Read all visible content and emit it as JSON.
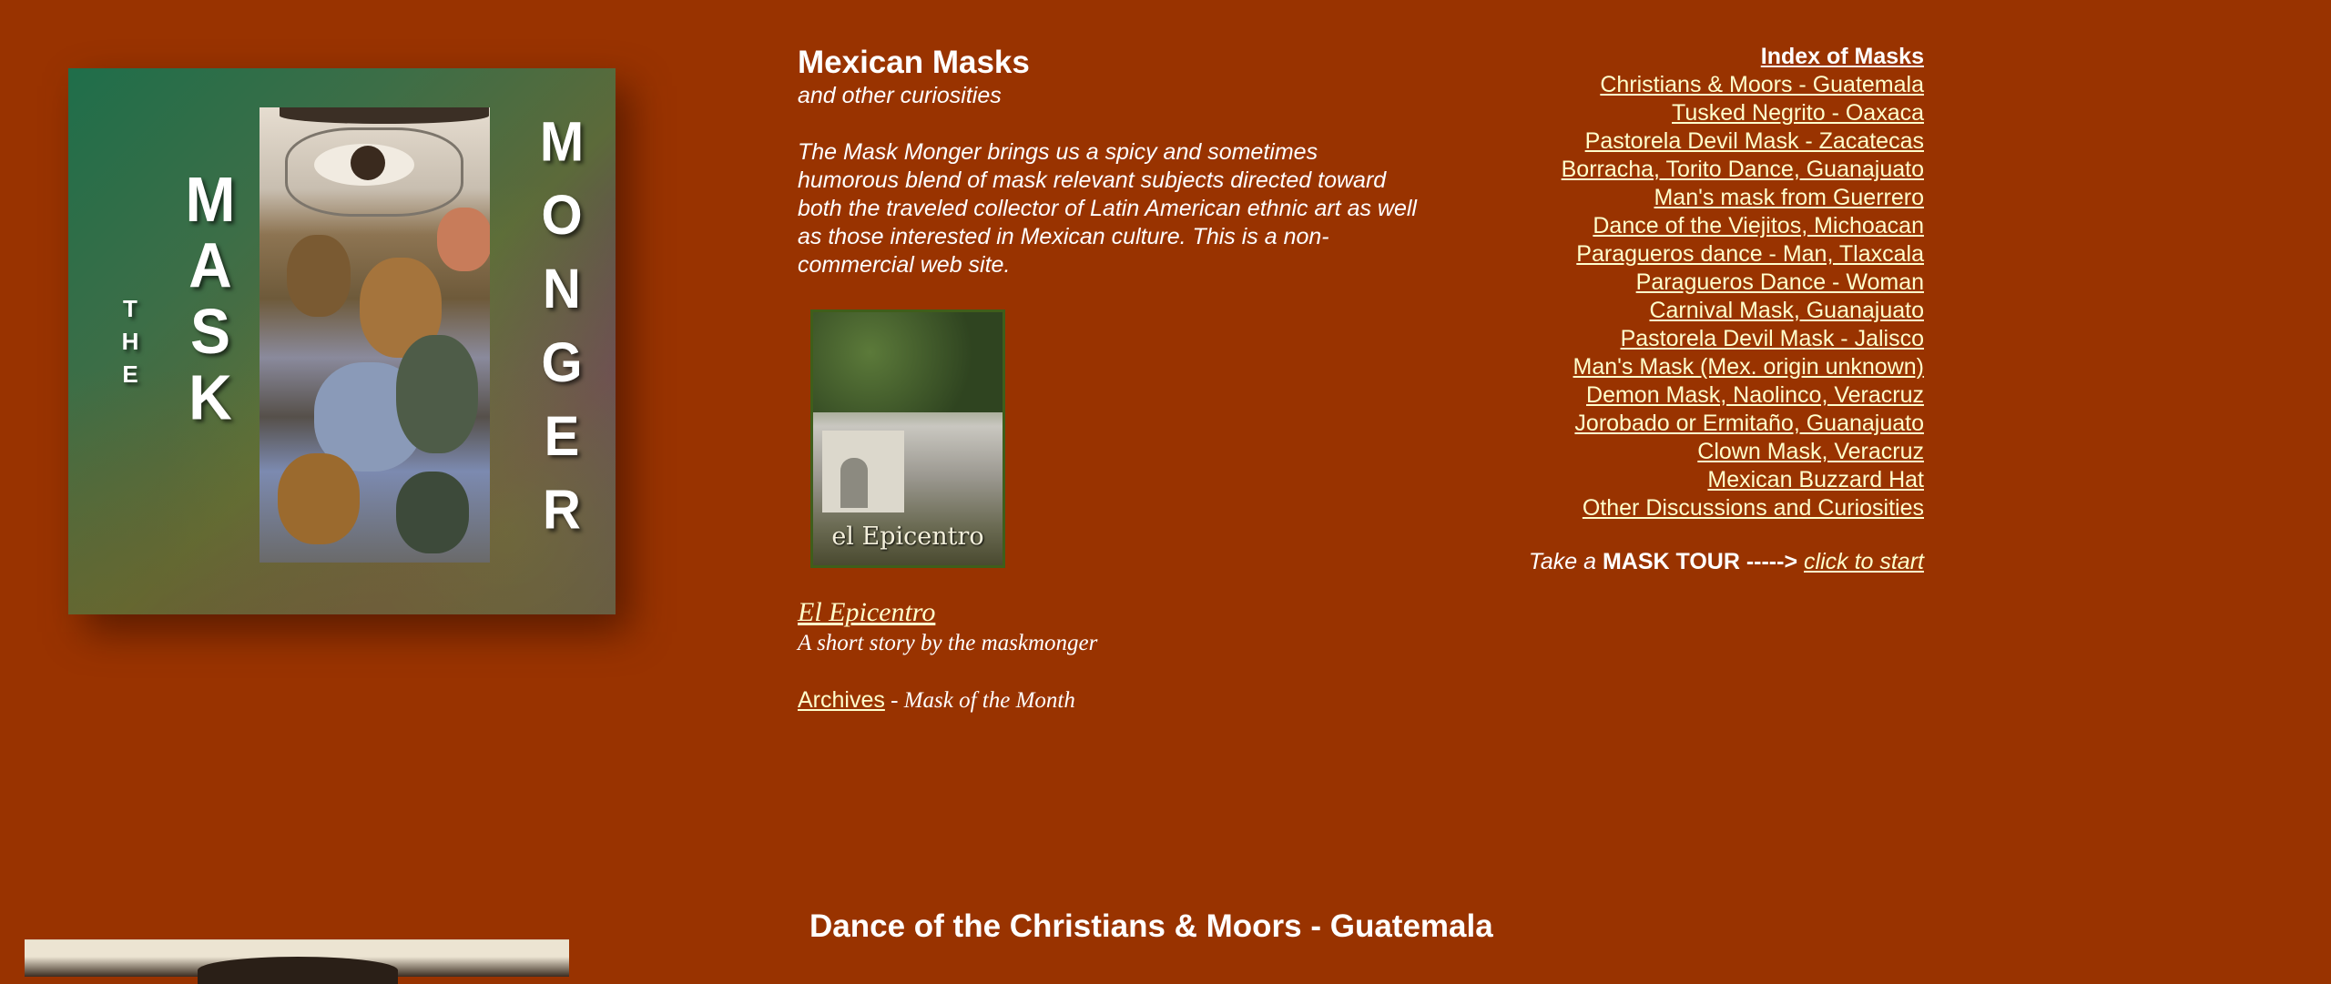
{
  "logo": {
    "alt": "The Mask Monger",
    "word_the": [
      "T",
      "H",
      "E"
    ],
    "word_mask": [
      "M",
      "A",
      "S",
      "K"
    ],
    "word_monger": [
      "M",
      "O",
      "N",
      "G",
      "E",
      "R"
    ]
  },
  "header": {
    "title": "Mexican Masks",
    "subtitle": "and other curiosities"
  },
  "intro": {
    "text": "The Mask Monger brings us a spicy and sometimes humorous blend of mask relevant subjects directed toward both the traveled collector of Latin American ethnic art as well as those interested in Mexican culture. This is a non-commercial web site."
  },
  "epicentro": {
    "thumb_caption": "el Epicentro",
    "link_label": "El Epicentro",
    "description": "A short story by the maskmonger"
  },
  "archives": {
    "link_label": "Archives",
    "suffix": " - Mask of the Month"
  },
  "index": {
    "title": "Index of Masks",
    "items": [
      "Christians & Moors - Guatemala",
      "Tusked Negrito - Oaxaca",
      "Pastorela Devil Mask - Zacatecas",
      "Borracha, Torito Dance, Guanajuato",
      "Man's mask from Guerrero",
      "Dance of the Viejitos, Michoacan",
      "Paragueros dance - Man, Tlaxcala",
      "Paragueros Dance - Woman",
      "Carnival Mask, Guanajuato",
      "Pastorela Devil Mask - Jalisco",
      "Man's Mask (Mex. origin unknown)",
      "Demon Mask, Naolinco, Veracruz",
      "Jorobado or Ermitaño, Guanajuato",
      "Clown Mask, Veracruz",
      "Mexican Buzzard Hat",
      "Other Discussions and Curiosities"
    ]
  },
  "tour": {
    "prefix": "Take a ",
    "bold": "MASK TOUR ----->",
    "link_label": "click to start"
  },
  "section": {
    "title": "Dance of the Christians & Moors - Guatemala"
  },
  "colors": {
    "background": "#993300",
    "link": "#ffffcc",
    "text": "#ffffff"
  }
}
